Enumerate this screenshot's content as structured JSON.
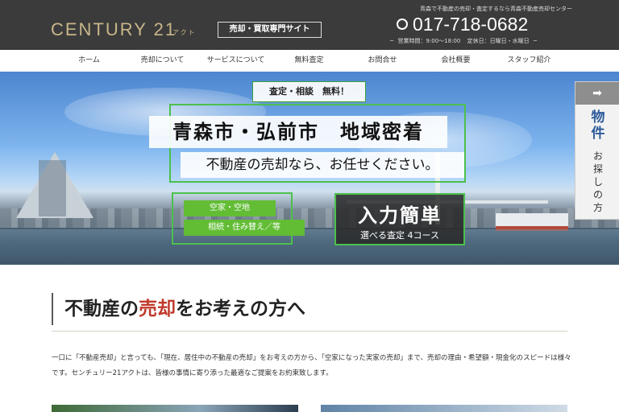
{
  "header": {
    "logo": "CENTURY 21",
    "logo_sub": "アクト",
    "site_badge": "売却・買取専門サイト",
    "tagline": "青森で不動産の売却・査定するなら青森不動産売却センター",
    "phone": "017-718-0682",
    "hours": "営業時間：9:00〜18:00",
    "closed": "定休日：日曜日・水曜日"
  },
  "nav": {
    "items": [
      "ホーム",
      "売却について",
      "サービスについて",
      "無料査定",
      "お問合せ",
      "会社概要",
      "スタッフ紹介"
    ]
  },
  "hero": {
    "free_label": "査定・相談　無料！",
    "headline": "青森市・弘前市　地域密着",
    "subline_bold": "不動産の売却",
    "subline_rest": "なら、お任せください。",
    "chip1": "空家・空地",
    "chip2": "相続・住み替え／等",
    "easy_title": "入力簡単",
    "easy_sub": "選べる査定 4コース"
  },
  "side_tab": {
    "arrow": "➡",
    "title": "物件",
    "subtitle": "お探しの方"
  },
  "intro": {
    "title_pre": "不動産の",
    "title_accent": "売却",
    "title_post": "をお考えの方へ",
    "body": "一口に「不動産売却」と言っても、「現在、居住中の不動産の売却」をお考えの方から、「空家になった実家の売却」まで、売却の理由・希望額・現金化のスピードは様々です。センチュリー21アクトは、皆様の事情に寄り添った最適なご提案をお約束致します。"
  }
}
